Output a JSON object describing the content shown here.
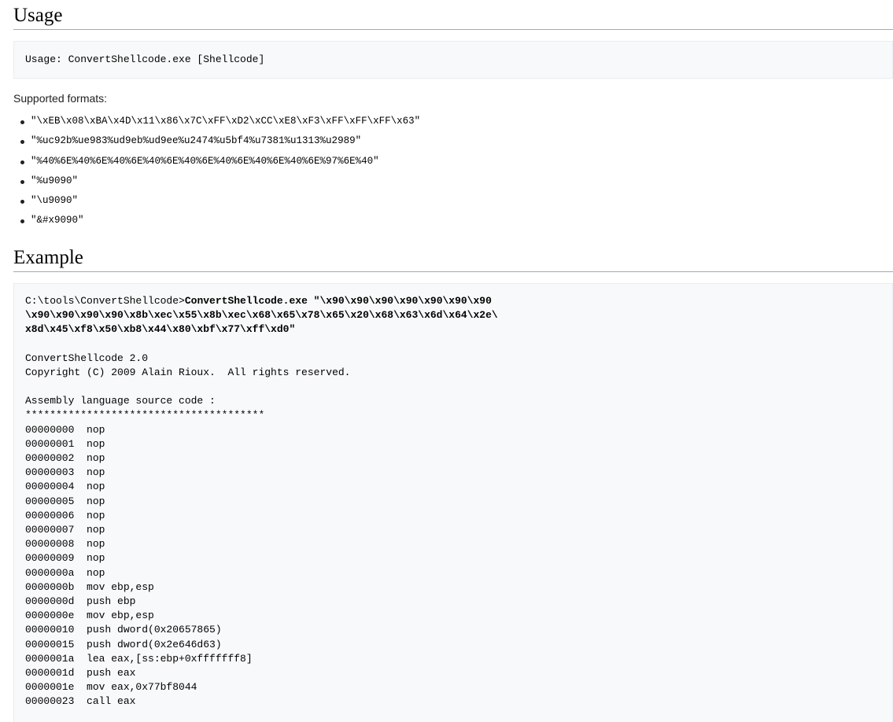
{
  "usage": {
    "heading": "Usage",
    "code": "Usage: ConvertShellcode.exe [Shellcode]"
  },
  "formats": {
    "intro": "Supported formats:",
    "items": [
      "\"\\xEB\\x08\\xBA\\x4D\\x11\\x86\\x7C\\xFF\\xD2\\xCC\\xE8\\xF3\\xFF\\xFF\\xFF\\x63\"",
      "\"%uc92b%ue983%ud9eb%ud9ee%u2474%u5bf4%u7381%u1313%u2989\"",
      "\"%40%6E%40%6E%40%6E%40%6E%40%6E%40%6E%40%6E%40%6E%97%6E%40\"",
      "\"%u9090\"",
      "\"\\u9090\"",
      "\"&#x9090\""
    ]
  },
  "example": {
    "heading": "Example",
    "prompt": "C:\\tools\\ConvertShellcode>",
    "command": "ConvertShellcode.exe \"\\x90\\x90\\x90\\x90\\x90\\x90\\x90\n\\x90\\x90\\x90\\x90\\x8b\\xec\\x55\\x8b\\xec\\x68\\x65\\x78\\x65\\x20\\x68\\x63\\x6d\\x64\\x2e\\\nx8d\\x45\\xf8\\x50\\xb8\\x44\\x80\\xbf\\x77\\xff\\xd0\"",
    "output": "\n\nConvertShellcode 2.0\nCopyright (C) 2009 Alain Rioux.  All rights reserved.\n\nAssembly language source code :\n***************************************\n00000000  nop\n00000001  nop\n00000002  nop\n00000003  nop\n00000004  nop\n00000005  nop\n00000006  nop\n00000007  nop\n00000008  nop\n00000009  nop\n0000000a  nop\n0000000b  mov ebp,esp\n0000000d  push ebp\n0000000e  mov ebp,esp\n00000010  push dword(0x20657865)\n00000015  push dword(0x2e646d63)\n0000001a  lea eax,[ss:ebp+0xfffffff8]\n0000001d  push eax\n0000001e  mov eax,0x77bf8044\n00000023  call eax"
  }
}
